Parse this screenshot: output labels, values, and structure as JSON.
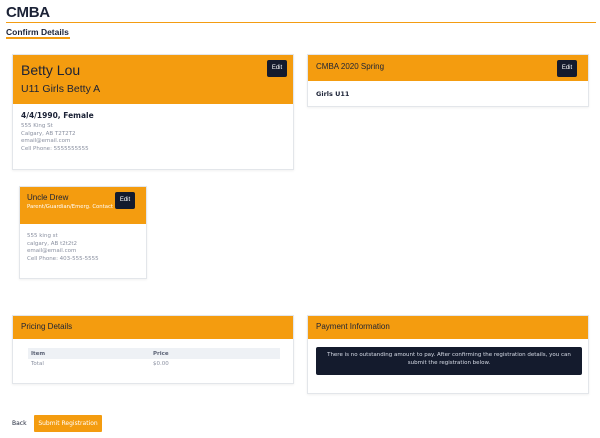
{
  "header": {
    "title": "CMBA",
    "subtitle": "Confirm Details"
  },
  "participant": {
    "name": "Betty Lou",
    "team": "U11 Girls Betty A",
    "edit_label": "Edit",
    "dob_gender": "4/4/1990, Female",
    "address1": "555 King St",
    "address2": "Calgary, AB T2T2T2",
    "email": "email@email.com",
    "phone": "Cell Phone: 5555555555"
  },
  "program": {
    "title": "CMBA 2020 Spring",
    "edit_label": "Edit",
    "division": "Girls U11"
  },
  "contact": {
    "name": "Uncle Drew",
    "role": "Parent/Guardian/Emerg. Contact",
    "edit_label": "Edit",
    "address1": "555 king st",
    "address2": "calgary, AB t2t2t2",
    "email": "email@email.com",
    "phone": "Cell Phone: 403-555-5555"
  },
  "pricing": {
    "title": "Pricing Details",
    "columns": [
      "Item",
      "Price"
    ],
    "rows": [
      {
        "item": "Total",
        "price": "$0.00"
      }
    ]
  },
  "payment": {
    "title": "Payment Information",
    "message": "There is no outstanding amount to pay. After confirming the registration details, you can submit the registration below."
  },
  "actions": {
    "back_label": "Back",
    "submit_label": "Submit Registration"
  },
  "colors": {
    "accent": "#f49c0f",
    "dark": "#141b2d"
  }
}
